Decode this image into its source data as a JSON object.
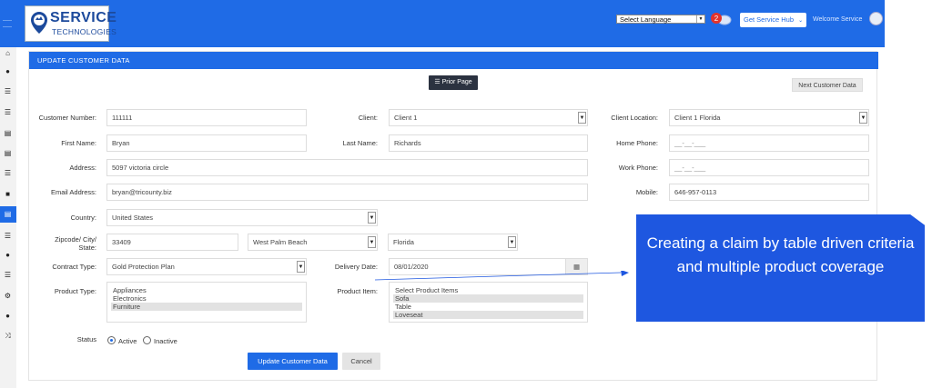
{
  "header": {
    "logo_line1": "SERVICE",
    "logo_line2": "TECHNOLOGIES",
    "language_select": "Select Language",
    "notification_count": "2",
    "hub_button": "Get Service Hub",
    "welcome": "Welcome Service"
  },
  "panel": {
    "title": "UPDATE CUSTOMER DATA",
    "prior_page": "Prior Page",
    "next_customer": "Next Customer Data"
  },
  "form": {
    "customer_number_label": "Customer Number:",
    "customer_number": "111111",
    "client_label": "Client:",
    "client": "Client 1",
    "client_location_label": "Client Location:",
    "client_location": "Client 1 Florida",
    "first_name_label": "First Name:",
    "first_name": "Bryan",
    "last_name_label": "Last Name:",
    "last_name": "Richards",
    "home_phone_label": "Home Phone:",
    "home_phone": "__-__-___",
    "address_label": "Address:",
    "address": "5097 victoria circle",
    "work_phone_label": "Work Phone:",
    "work_phone": "__-__-___",
    "email_label": "Email Address:",
    "email": "bryan@tricounty.biz",
    "mobile_label": "Mobile:",
    "mobile": "646-957-0113",
    "country_label": "Country:",
    "country": "United States",
    "zip_label": "Zipcode/ City/ State:",
    "zip": "33409",
    "city": "West Palm Beach",
    "state": "Florida",
    "contract_type_label": "Contract Type:",
    "contract_type": "Gold Protection Plan",
    "delivery_date_label": "Delivery Date:",
    "delivery_date": "08/01/2020",
    "product_type_label": "Product Type:",
    "product_types": [
      {
        "label": "Appliances",
        "selected": false
      },
      {
        "label": "Electronics",
        "selected": false
      },
      {
        "label": "Furniture",
        "selected": true
      }
    ],
    "product_item_label": "Product Item:",
    "product_items": [
      {
        "label": "Select Product Items",
        "selected": false
      },
      {
        "label": "Sofa",
        "selected": true
      },
      {
        "label": "Table",
        "selected": false
      },
      {
        "label": "Loveseat",
        "selected": true
      }
    ],
    "status_label": "Status",
    "status_active": "Active",
    "status_inactive": "Inactive",
    "update_button": "Update Customer Data",
    "cancel_button": "Cancel"
  },
  "callout": {
    "text": "Creating a claim by table driven criteria and multiple product coverage"
  },
  "colors": {
    "primary": "#1f6be6",
    "callout": "#1e57e0",
    "dark_button": "#2b3240"
  }
}
